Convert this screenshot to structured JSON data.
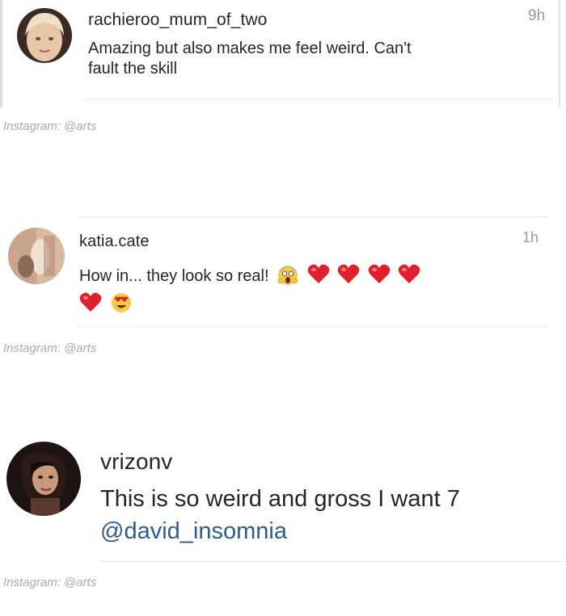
{
  "comments": [
    {
      "username": "rachieroo_mum_of_two",
      "time": "9h",
      "text_line1": "Amazing but also makes me feel weird. Can't",
      "text_line2": "fault the skill"
    },
    {
      "username": "katia.cate",
      "time": "1h",
      "text": "How in... they look so real!",
      "emojis": [
        "face-screaming-in-fear",
        "red-heart",
        "red-heart",
        "red-heart",
        "red-heart",
        "red-heart",
        "smiling-face-with-heart-eyes"
      ]
    },
    {
      "username": "vrizonv",
      "text": "This is so weird and gross I want 7",
      "mention": "@david_insomnia"
    }
  ],
  "credits": [
    "Instagram: @arts",
    "Instagram: @arts",
    "Instagram: @arts"
  ],
  "colors": {
    "mention": "#2d5d8c",
    "heart": "#e0202c",
    "credit": "#aaaaaa"
  }
}
